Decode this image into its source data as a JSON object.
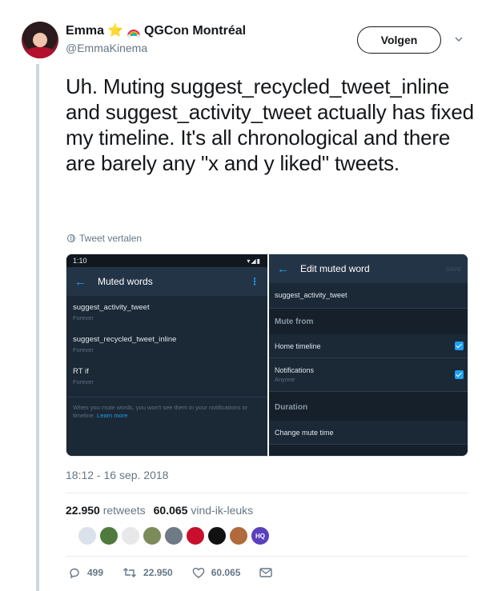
{
  "author": {
    "display_name": "Emma",
    "emoji_star": "⭐",
    "event": "QGCon Montréal",
    "handle": "@EmmaKinema"
  },
  "follow_label": "Volgen",
  "tweet_text": "Uh. Muting suggest_recycled_tweet_inline and suggest_activity_tweet actually has fixed my timeline. It's all chronological and there are barely any \"x and y liked\" tweets.",
  "translate_label": "Tweet vertalen",
  "media": {
    "left": {
      "status_time": "1:10",
      "title": "Muted words",
      "items": [
        {
          "word": "suggest_activity_tweet",
          "duration": "Forever"
        },
        {
          "word": "suggest_recycled_tweet_inline",
          "duration": "Forever"
        },
        {
          "word": "RT if",
          "duration": "Forever"
        }
      ],
      "note": "When you mute words, you won't see them in your notifications or timeline.",
      "note_link": "Learn more"
    },
    "right": {
      "title": "Edit muted word",
      "save": "SAVE",
      "input_value": "suggest_activity_tweet",
      "mute_from_label": "Mute from",
      "home_timeline": "Home timeline",
      "notifications": "Notifications",
      "notifications_sub": "Anyone",
      "duration_label": "Duration",
      "change_mute_time": "Change mute time"
    }
  },
  "timestamp": "18:12 - 16 sep. 2018",
  "stats": {
    "retweets_count": "22.950",
    "retweets_label": "retweets",
    "likes_count": "60.065",
    "likes_label": "vind-ik-leuks"
  },
  "liker_colors": [
    "#d9e2ea",
    "#4f7a3d",
    "#e8e8e8",
    "#7b8b5a",
    "#6e7a86",
    "#c8102e",
    "#111111",
    "#b06a3b",
    "#5a3fbf"
  ],
  "liker_badge": "HQ",
  "actions": {
    "replies": "499",
    "retweets": "22.950",
    "likes": "60.065"
  }
}
